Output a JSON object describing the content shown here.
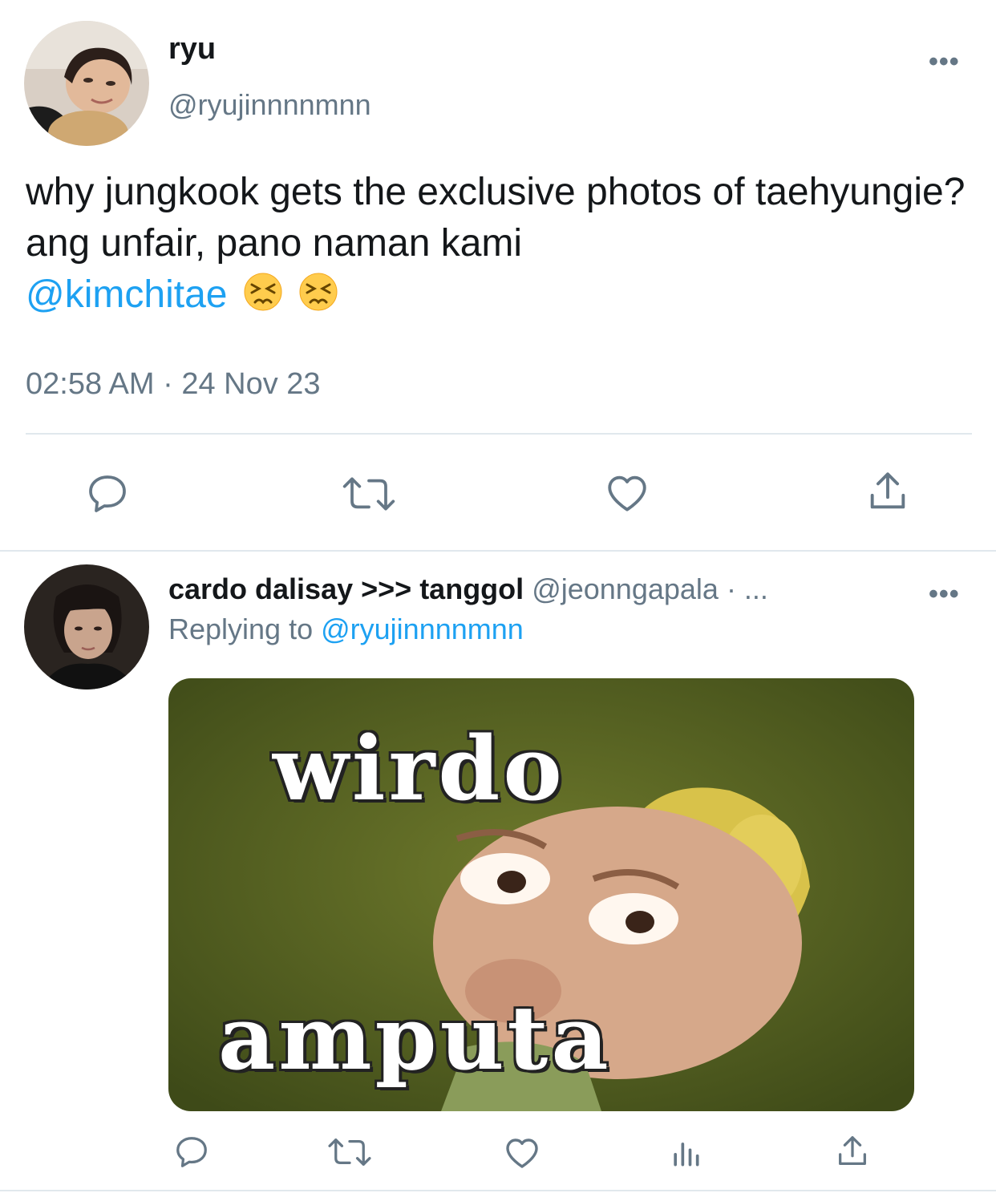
{
  "tweet": {
    "display_name": "ryu",
    "handle": "@ryujinnnnmnn",
    "text": "why jungkook gets the exclusive photos of taehyungie? ang unfair, pano naman kami",
    "mention": "@kimchitae",
    "emoji": [
      "persevering-face",
      "persevering-face"
    ],
    "time": "02:58 AM",
    "separator": "·",
    "date": "24 Nov 23",
    "more_label": "•••"
  },
  "reply": {
    "display_name": "cardo dalisay >>> tanggol",
    "handle": "@jeonngapala",
    "meta_suffix": "· ...",
    "replying_label": "Replying to",
    "replying_handle": "@ryujinnnnmnn",
    "more_label": "•••",
    "media_text_top": "wirdo",
    "media_text_bottom": "amputa"
  },
  "colors": {
    "link": "#1da1f2",
    "secondary": "#657786",
    "divider": "#e1e8ed"
  }
}
